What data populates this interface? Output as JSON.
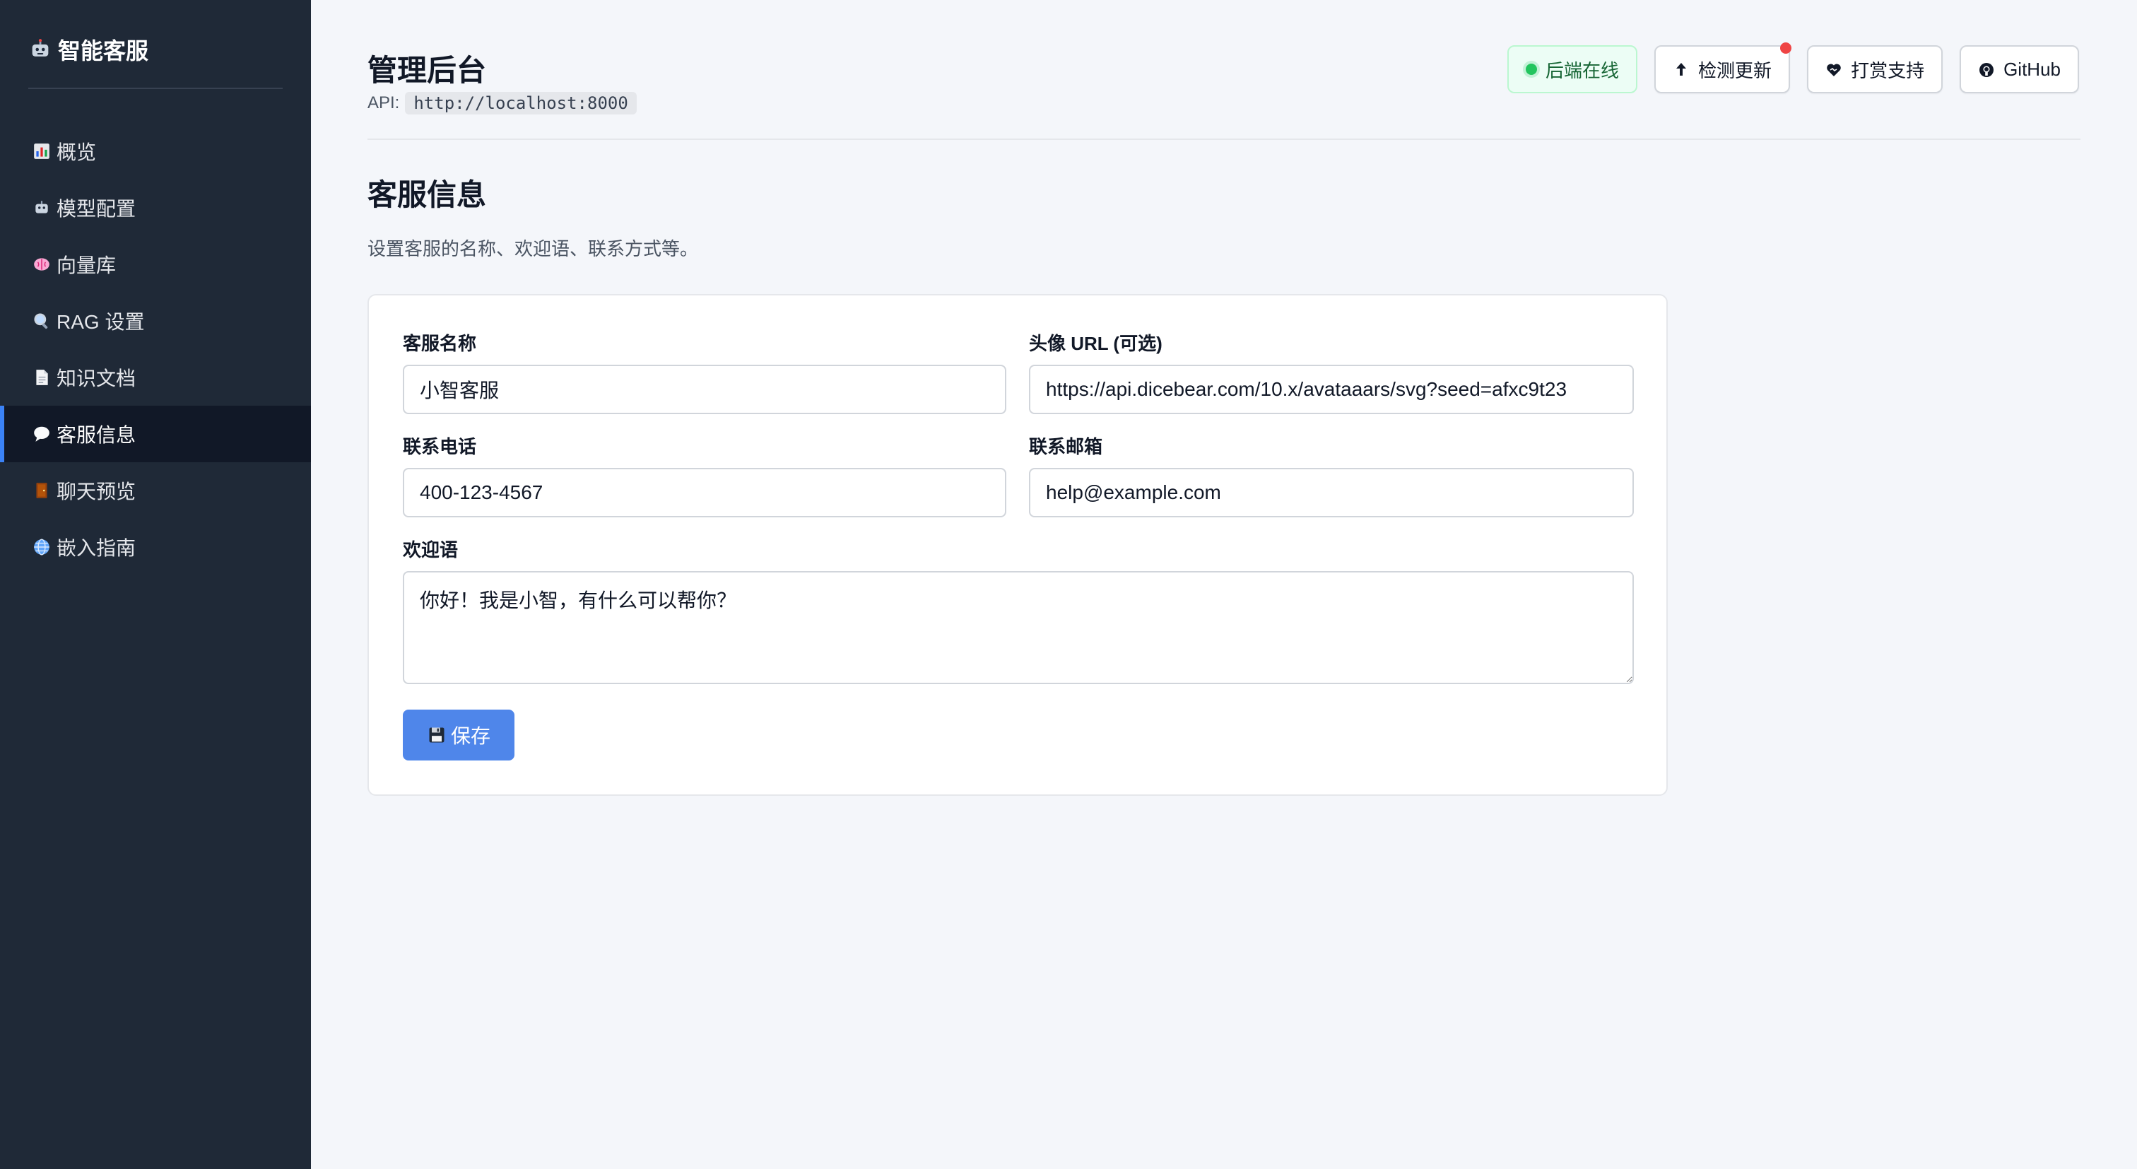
{
  "sidebar": {
    "brand": "智能客服",
    "brand_icon": "robot-icon",
    "items": [
      {
        "label": "概览",
        "icon": "bar-chart-icon"
      },
      {
        "label": "模型配置",
        "icon": "robot-icon"
      },
      {
        "label": "向量库",
        "icon": "brain-icon"
      },
      {
        "label": "RAG 设置",
        "icon": "magnifier-icon"
      },
      {
        "label": "知识文档",
        "icon": "document-icon"
      },
      {
        "label": "客服信息",
        "icon": "speech-bubble-icon",
        "active": true
      },
      {
        "label": "聊天预览",
        "icon": "door-icon"
      },
      {
        "label": "嵌入指南",
        "icon": "globe-icon"
      }
    ]
  },
  "header": {
    "title": "管理后台",
    "api_label": "API:",
    "api_value": "http://localhost:8000",
    "status": "后端在线",
    "check_update": "检测更新",
    "donate": "打赏支持",
    "github": "GitHub"
  },
  "section": {
    "title": "客服信息",
    "description": "设置客服的名称、欢迎语、联系方式等。"
  },
  "form": {
    "name_label": "客服名称",
    "name_value": "小智客服",
    "avatar_label": "头像 URL (可选)",
    "avatar_value": "https://api.dicebear.com/10.x/avataaars/svg?seed=afxc9t23",
    "phone_label": "联系电话",
    "phone_value": "400-123-4567",
    "email_label": "联系邮箱",
    "email_value": "help@example.com",
    "welcome_label": "欢迎语",
    "welcome_value": "你好！我是小智，有什么可以帮你？",
    "save_label": "保存"
  },
  "colors": {
    "sidebar_bg": "#1f2937",
    "accent": "#3b82f6",
    "primary_button": "#4f86ea",
    "status_green": "#22c55e",
    "notify_red": "#ef4444"
  }
}
